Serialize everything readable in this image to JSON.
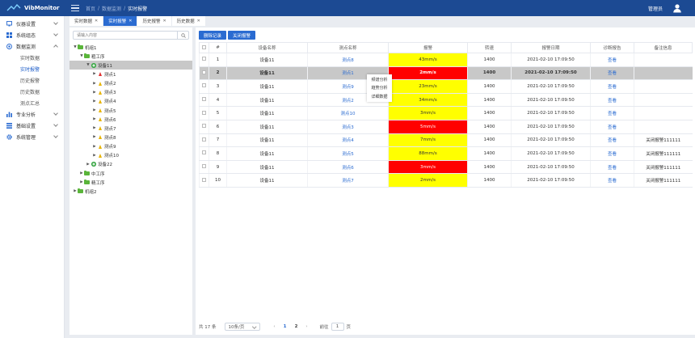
{
  "header": {
    "app_name": "VibMonitor",
    "breadcrumb": [
      "首页",
      "数据监测",
      "实时报警"
    ],
    "user": "管理员"
  },
  "sidebar": {
    "groups": [
      {
        "label": "仪器设置",
        "icon": "monitor-icon"
      },
      {
        "label": "系统组态",
        "icon": "grid-icon"
      },
      {
        "label": "数据监测",
        "icon": "target-icon",
        "open": true,
        "items": [
          "实时数据",
          "实时报警",
          "历史报警",
          "历史数据",
          "测点汇总"
        ]
      },
      {
        "label": "专业分析",
        "icon": "bar-chart-icon"
      },
      {
        "label": "基础设置",
        "icon": "list-icon"
      },
      {
        "label": "系统管理",
        "icon": "gear-icon"
      }
    ],
    "active_item": "实时报警"
  },
  "tabs": [
    {
      "label": "实时数据"
    },
    {
      "label": "实时报警",
      "active": true
    },
    {
      "label": "历史报警"
    },
    {
      "label": "历史数据"
    }
  ],
  "tree": {
    "search_placeholder": "请输入内容",
    "nodes": [
      {
        "label": "机组1",
        "level": 0,
        "expanded": true,
        "icon": "folder"
      },
      {
        "label": "粗工序",
        "level": 1,
        "expanded": true,
        "icon": "folder"
      },
      {
        "label": "设备11",
        "level": 2,
        "expanded": true,
        "icon": "gear",
        "selected": true
      },
      {
        "label": "测点1",
        "level": 3,
        "icon": "tri-red"
      },
      {
        "label": "测点2",
        "level": 3,
        "icon": "tri"
      },
      {
        "label": "测点3",
        "level": 3,
        "icon": "tri"
      },
      {
        "label": "测点4",
        "level": 3,
        "icon": "tri"
      },
      {
        "label": "测点5",
        "level": 3,
        "icon": "tri"
      },
      {
        "label": "测点6",
        "level": 3,
        "icon": "tri"
      },
      {
        "label": "测点7",
        "level": 3,
        "icon": "tri"
      },
      {
        "label": "测点8",
        "level": 3,
        "icon": "tri"
      },
      {
        "label": "测点9",
        "level": 3,
        "icon": "tri"
      },
      {
        "label": "测点10",
        "level": 3,
        "icon": "tri"
      },
      {
        "label": "设备22",
        "level": 2,
        "icon": "gear"
      },
      {
        "label": "中工序",
        "level": 1,
        "icon": "folder"
      },
      {
        "label": "精工序",
        "level": 1,
        "icon": "folder"
      },
      {
        "label": "机组2",
        "level": 0,
        "icon": "folder"
      }
    ]
  },
  "toolbar": {
    "delete_label": "删除记录",
    "close_label": "关闭报警"
  },
  "table": {
    "columns": [
      "#",
      "设备名称",
      "测点名称",
      "报警",
      "转速",
      "报警日期",
      "诊断报告",
      "备注信息"
    ],
    "rows": [
      {
        "idx": "1",
        "device": "设备11",
        "point": "测点8",
        "value": "43mm/s",
        "level": "yellow",
        "speed": "1400",
        "date": "2021-02-10 17:09:50",
        "report": "查看",
        "note": ""
      },
      {
        "idx": "2",
        "device": "设备11",
        "point": "测点1",
        "value": "2mm/s",
        "level": "red",
        "speed": "1400",
        "date": "2021-02-10 17:09:50",
        "report": "查看",
        "note": "",
        "selected": true
      },
      {
        "idx": "3",
        "device": "设备11",
        "point": "测点9",
        "value": "23mm/s",
        "level": "yellow",
        "speed": "1400",
        "date": "2021-02-10 17:09:50",
        "report": "查看",
        "note": ""
      },
      {
        "idx": "4",
        "device": "设备11",
        "point": "测点2",
        "value": "34mm/s",
        "level": "yellow",
        "speed": "1400",
        "date": "2021-02-10 17:09:50",
        "report": "查看",
        "note": ""
      },
      {
        "idx": "5",
        "device": "设备11",
        "point": "测点10",
        "value": "3mm/s",
        "level": "yellow",
        "speed": "1400",
        "date": "2021-02-10 17:09:50",
        "report": "查看",
        "note": ""
      },
      {
        "idx": "6",
        "device": "设备11",
        "point": "测点3",
        "value": "5mm/s",
        "level": "red",
        "speed": "1400",
        "date": "2021-02-10 17:09:50",
        "report": "查看",
        "note": ""
      },
      {
        "idx": "7",
        "device": "设备11",
        "point": "测点4",
        "value": "7mm/s",
        "level": "yellow",
        "speed": "1400",
        "date": "2021-02-10 17:09:50",
        "report": "查看",
        "note": "关闭报警111111"
      },
      {
        "idx": "8",
        "device": "设备11",
        "point": "测点5",
        "value": "88mm/s",
        "level": "yellow",
        "speed": "1400",
        "date": "2021-02-10 17:09:50",
        "report": "查看",
        "note": "关闭报警111111"
      },
      {
        "idx": "9",
        "device": "设备11",
        "point": "测点6",
        "value": "3mm/s",
        "level": "red",
        "speed": "1400",
        "date": "2021-02-10 17:09:50",
        "report": "查看",
        "note": "关闭报警111111"
      },
      {
        "idx": "10",
        "device": "设备11",
        "point": "测点7",
        "value": "2mm/s",
        "level": "yellow",
        "speed": "1400",
        "date": "2021-02-10 17:09:50",
        "report": "查看",
        "note": "关闭报警111111"
      }
    ]
  },
  "context_menu": [
    "频谱分析",
    "趋势分析",
    "详细数据"
  ],
  "pager": {
    "total": "共 17 条",
    "page_size": "10条/页",
    "pages": [
      "1",
      "2"
    ],
    "current": "1",
    "goto_label": "前往",
    "goto_value": "1",
    "page_unit": "页"
  },
  "colors": {
    "header": "#1c4a93",
    "accent": "#2a6bd1",
    "alarm_yellow": "#ffff00",
    "alarm_red": "#ff0000"
  }
}
